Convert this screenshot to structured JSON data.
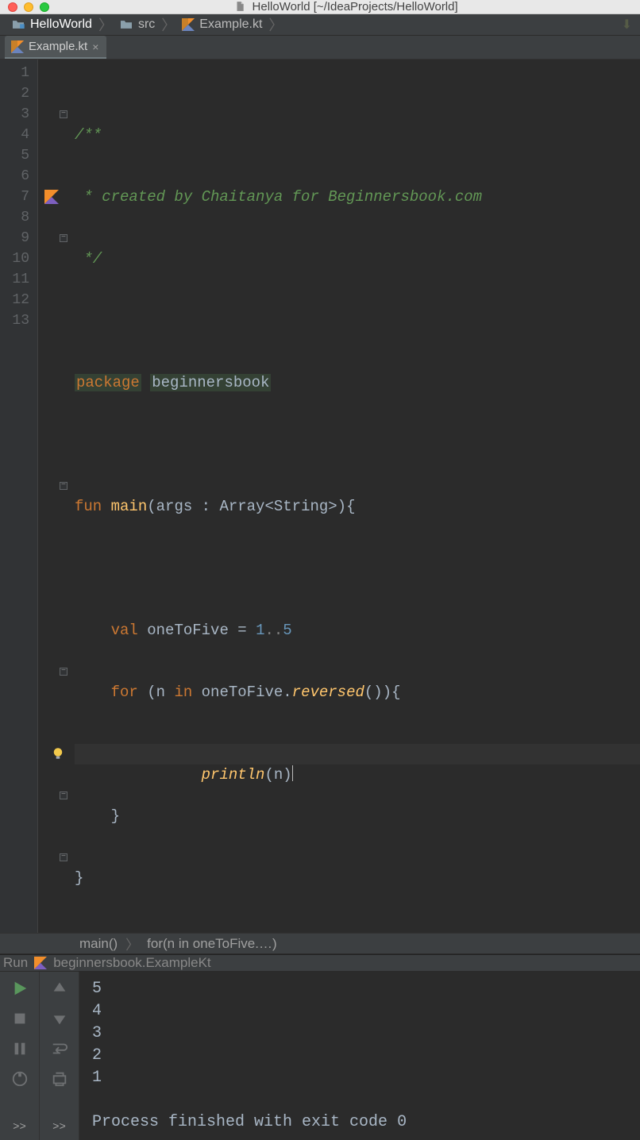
{
  "window": {
    "title": "HelloWorld [~/IdeaProjects/HelloWorld]"
  },
  "breadcrumbs": {
    "project": "HelloWorld",
    "folder": "src",
    "file": "Example.kt"
  },
  "tab": {
    "label": "Example.kt"
  },
  "gutter": {
    "lines": [
      "1",
      "2",
      "3",
      "4",
      "5",
      "6",
      "7",
      "8",
      "9",
      "10",
      "11",
      "12",
      "13"
    ]
  },
  "code": {
    "l1_open": "/**",
    "l2": " * created by Chaitanya for Beginnersbook.com",
    "l3": " */",
    "l5_pkg": "package",
    "l5_name": "beginnersbook",
    "l7_fun": "fun",
    "l7_main": "main",
    "l7_args": "(args : Array<String>){",
    "l9_val": "val",
    "l9_name": "oneToFive = ",
    "l9_a": "1",
    "l9_range": "..",
    "l9_b": "5",
    "l10_for": "for",
    "l10_open": " (n ",
    "l10_in": "in",
    "l10_rest": " oneToFive.",
    "l10_rev": "reversed",
    "l10_close": "()){",
    "l11_println": "println",
    "l11_arg": "(n)",
    "l12": "}",
    "l13": "}"
  },
  "code_breadcrumb": {
    "a": "main()",
    "b": "for(n in oneToFive.…)"
  },
  "run_header": {
    "label": "Run",
    "config": "beginnersbook.ExampleKt"
  },
  "console": {
    "lines": {
      "l1": "5",
      "l2": "4",
      "l3": "3",
      "l4": "2",
      "l5": "1",
      "l7": "Process finished with exit code 0"
    }
  },
  "more_label": ">>"
}
